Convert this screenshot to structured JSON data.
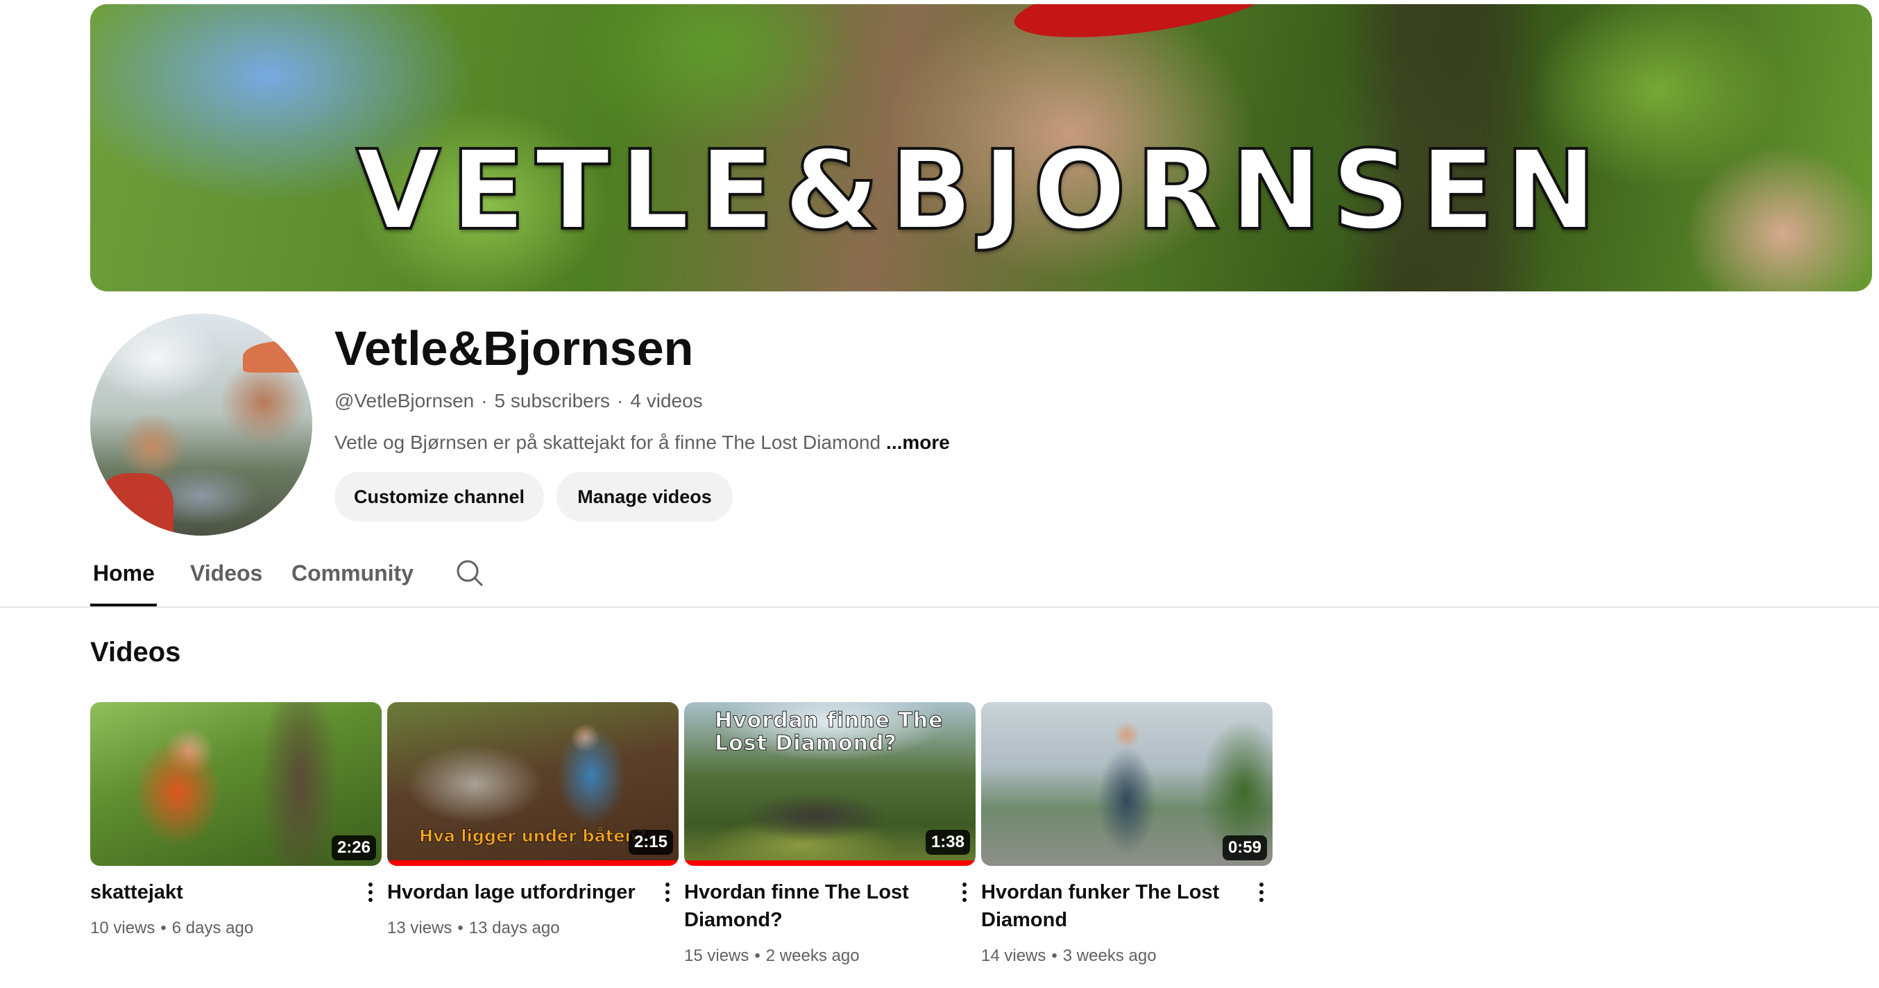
{
  "banner": {
    "title": "VETLE&BJORNSEN"
  },
  "channel": {
    "name": "Vetle&Bjornsen",
    "handle": "@VetleBjornsen",
    "subscribers": "5 subscribers",
    "video_count": "4 videos",
    "separator": "·",
    "description": "Vetle og Bjørnsen er på skattejakt for å finne The Lost Diamond",
    "more_label": "...more"
  },
  "buttons": {
    "customize": "Customize channel",
    "manage": "Manage videos"
  },
  "tabs": [
    {
      "label": "Home",
      "active": true
    },
    {
      "label": "Videos",
      "active": false
    },
    {
      "label": "Community",
      "active": false
    }
  ],
  "section": {
    "title": "Videos"
  },
  "videos": [
    {
      "title": "skattejakt",
      "views": "10 views",
      "age": "6 days ago",
      "duration": "2:26",
      "watched_fraction": 0,
      "overlay": ""
    },
    {
      "title": "Hvordan lage utfordringer",
      "views": "13 views",
      "age": "13 days ago",
      "duration": "2:15",
      "watched_fraction": 1.0,
      "overlay": "Hva ligger under båten?"
    },
    {
      "title": "Hvordan finne The Lost Diamond?",
      "views": "15 views",
      "age": "2 weeks ago",
      "duration": "1:38",
      "watched_fraction": 1.0,
      "overlay": "Hvordan finne The Lost Diamond?"
    },
    {
      "title": "Hvordan funker The Lost Diamond",
      "views": "14 views",
      "age": "3 weeks ago",
      "duration": "0:59",
      "watched_fraction": 0,
      "overlay": ""
    }
  ],
  "meta_separator": "•",
  "colors": {
    "progress": "#ff0000",
    "text_primary": "#0f0f0f",
    "text_secondary": "#606060",
    "button_bg": "#f2f2f2"
  }
}
